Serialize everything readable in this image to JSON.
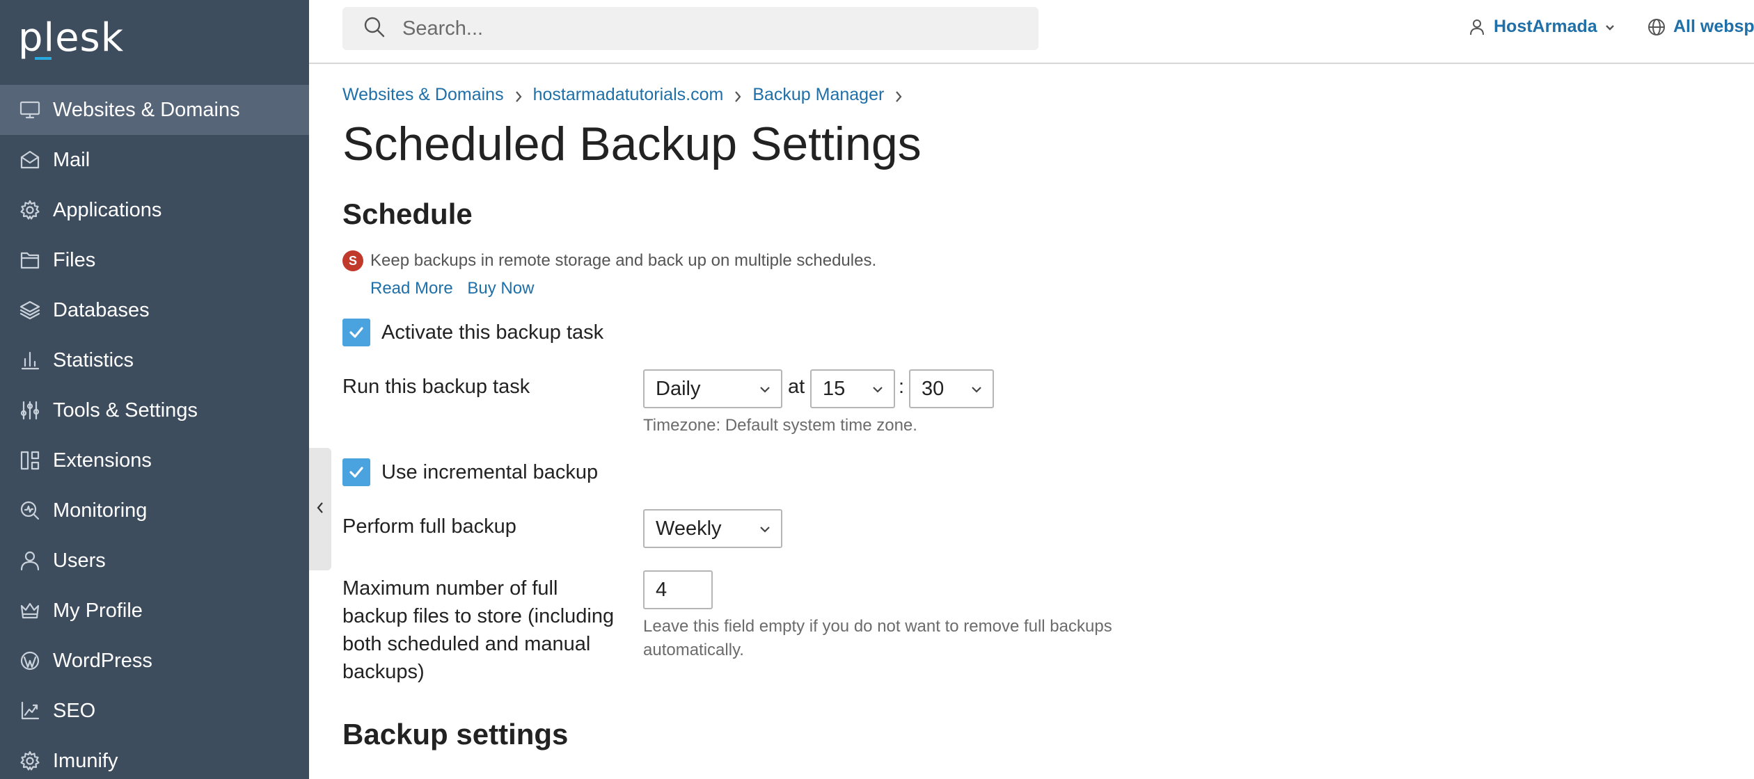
{
  "sidebar": {
    "logo": "plesk",
    "items": [
      {
        "label": "Websites & Domains",
        "icon": "monitor-icon",
        "active": true
      },
      {
        "label": "Mail",
        "icon": "mail-icon"
      },
      {
        "label": "Applications",
        "icon": "gear-icon"
      },
      {
        "label": "Files",
        "icon": "folder-icon"
      },
      {
        "label": "Databases",
        "icon": "layers-icon"
      },
      {
        "label": "Statistics",
        "icon": "bar-chart-icon"
      },
      {
        "label": "Tools & Settings",
        "icon": "sliders-icon"
      },
      {
        "label": "Extensions",
        "icon": "grid-icon"
      },
      {
        "label": "Monitoring",
        "icon": "monitoring-icon"
      },
      {
        "label": "Users",
        "icon": "user-icon"
      },
      {
        "label": "My Profile",
        "icon": "crown-icon"
      },
      {
        "label": "WordPress",
        "icon": "wordpress-icon"
      },
      {
        "label": "SEO",
        "icon": "seo-icon"
      },
      {
        "label": "Imunify",
        "icon": "gear-icon"
      }
    ]
  },
  "header": {
    "search_placeholder": "Search...",
    "user_name": "HostArmada",
    "webspaces_label": "All webspa"
  },
  "breadcrumb": [
    "Websites & Domains",
    "hostarmadatutorials.com",
    "Backup Manager"
  ],
  "page_title": "Scheduled Backup Settings",
  "schedule": {
    "title": "Schedule",
    "promo_badge": "S",
    "promo_text": "Keep backups in remote storage and back up on multiple schedules.",
    "read_more": "Read More",
    "buy_now": "Buy Now",
    "activate_label": "Activate this backup task",
    "run_label": "Run this backup task",
    "frequency": "Daily",
    "at_label": "at",
    "hour": "15",
    "colon": ":",
    "minute": "30",
    "timezone_hint": "Timezone: Default system time zone.",
    "incremental_label": "Use incremental backup",
    "full_backup_label": "Perform full backup",
    "full_backup_frequency": "Weekly",
    "max_files_label": "Maximum number of full backup files to store (including both scheduled and manual backups)",
    "max_files_value": "4",
    "max_files_hint": "Leave this field empty if you do not want to remove full backups automatically."
  },
  "backup_settings": {
    "title": "Backup settings"
  },
  "colors": {
    "sidebar_bg": "#3e4d5e",
    "sidebar_active": "#566578",
    "link": "#1f6fa8",
    "checkbox": "#4aa3df",
    "promo_badge": "#c0392b"
  }
}
